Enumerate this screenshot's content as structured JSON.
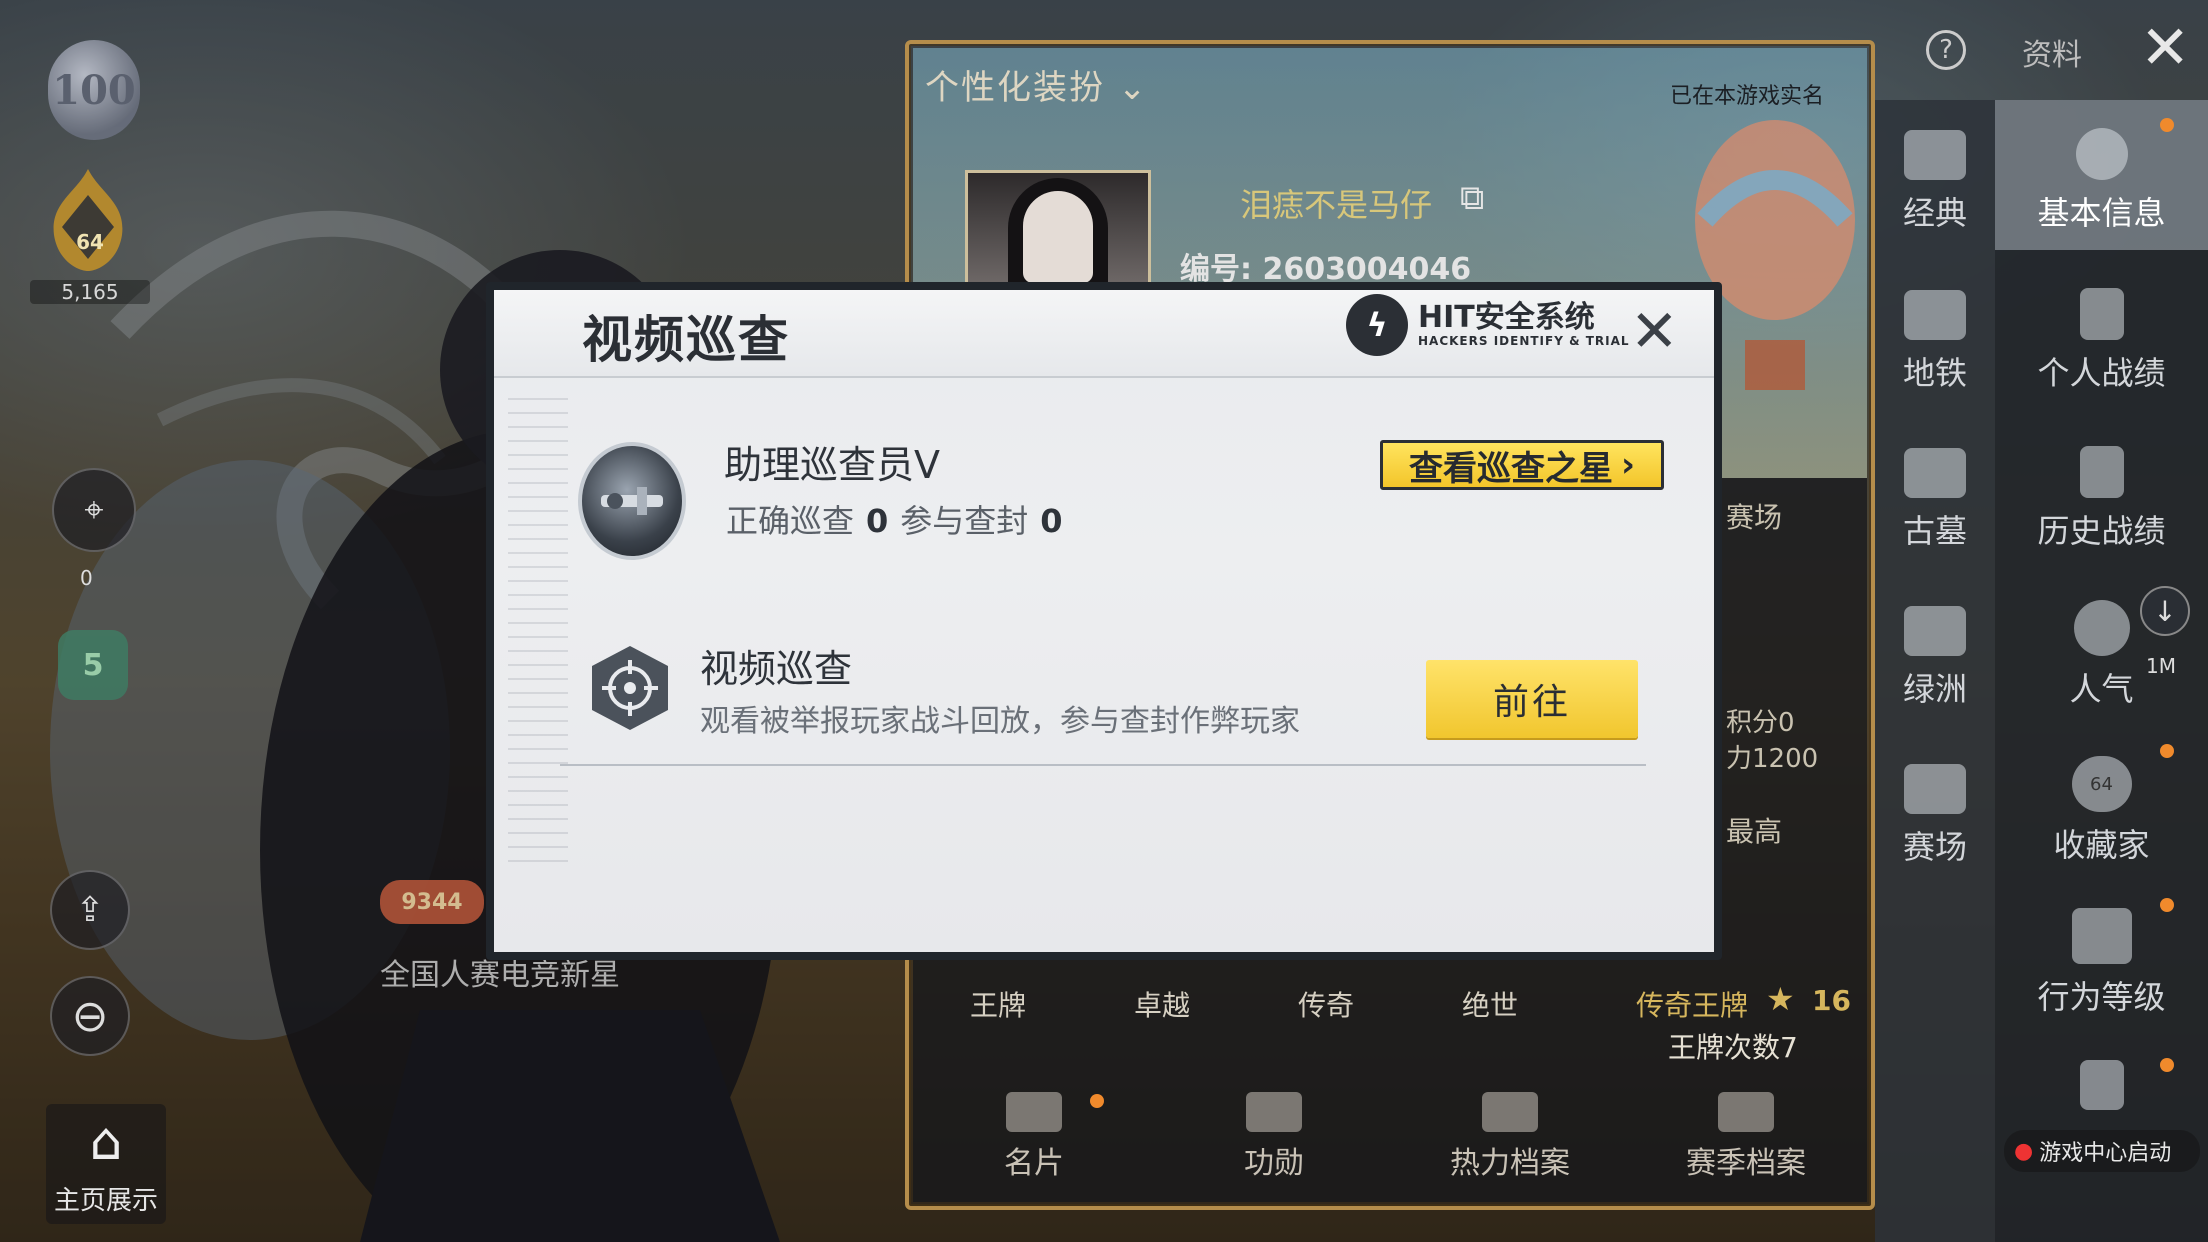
{
  "hud": {
    "level": "100",
    "rank_level": "64",
    "rank_points": "5,165",
    "weapon_count": "0",
    "season_level": "5",
    "home_label": "主页展示",
    "title_banner": "全国人赛电竞新星",
    "banner_score": "9344"
  },
  "profile": {
    "customize_tab": "个性化装扮",
    "realname_status": "已在本游戏实名",
    "nickname": "泪痣不是马仔",
    "uid": "编号: 2603004046",
    "peek_arena": "赛场",
    "peek_score": "积分0",
    "peek_power": "力1200",
    "peek_highest": "最高",
    "ranks": [
      "王牌",
      "卓越",
      "传奇",
      "绝世"
    ],
    "legend_ace": "传奇王牌",
    "legend_stars": "16",
    "ace_count": "王牌次数7",
    "bottom_tabs": [
      "名片",
      "功勋",
      "热力档案",
      "赛季档案"
    ]
  },
  "nav": {
    "help": "?",
    "data_tab": "资料",
    "modes": [
      "经典",
      "地铁",
      "古墓",
      "绿洲",
      "赛场"
    ],
    "sections": [
      "基本信息",
      "个人战绩",
      "历史战绩",
      "人气",
      "收藏家",
      "行为等级"
    ],
    "popularity_count": "1M",
    "collector_level": "64",
    "game_center": "游戏中心启动"
  },
  "modal": {
    "title": "视频巡查",
    "logo_main": "HIT安全系统",
    "logo_sub": "HACKERS IDENTIFY & TRIAL",
    "role": "助理巡查员V",
    "stat1_label": "正确巡查",
    "stat1_value": "0",
    "stat2_label": "参与查封",
    "stat2_value": "0",
    "star_button": "查看巡查之星",
    "row_title": "视频巡查",
    "row_desc": "观看被举报玩家战斗回放，参与查封作弊玩家",
    "go_button": "前往"
  },
  "colors": {
    "accent_yellow": "#f3c52a",
    "notify_dot": "#f08a2c",
    "gold_frame": "#b58d4b"
  }
}
